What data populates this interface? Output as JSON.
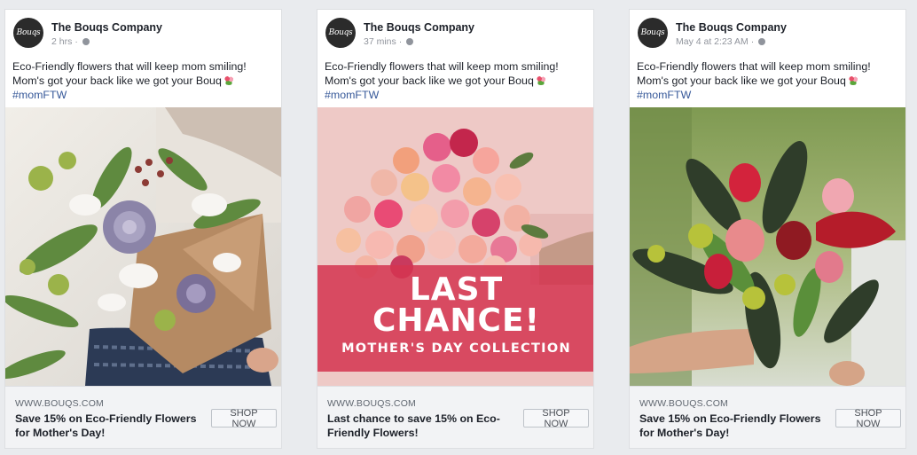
{
  "brand": {
    "page_name": "The Bouqs Company",
    "avatar_text": "Bouqs"
  },
  "posts": [
    {
      "time": "2 hrs",
      "separator": "·",
      "body_line1": "Eco-Friendly flowers that will keep mom smiling!",
      "body_line2": "Mom's got your back like we got your Bouq",
      "hashtag": "#momFTW",
      "link_url": "WWW.BOUQS.COM",
      "headline": "Save 15% on Eco-Friendly Flowers for Mother's Day!",
      "cta": "SHOP NOW",
      "image": "mixed-bouquet-in-kraft-paper"
    },
    {
      "time": "37 mins",
      "separator": "·",
      "body_line1": "Eco-Friendly flowers that will keep mom smiling!",
      "body_line2": "Mom's got your back like we got your Bouq",
      "hashtag": "#momFTW",
      "link_url": "WWW.BOUQS.COM",
      "headline": "Last chance to save 15% on Eco-Friendly Flowers!",
      "cta": "SHOP NOW",
      "image": "pink-rose-bouquet",
      "overlay_line1": "LAST",
      "overlay_line2": "CHANCE!",
      "overlay_sub": "MOTHER'S DAY COLLECTION"
    },
    {
      "time": "May 4 at 2:23 AM",
      "separator": "·",
      "body_line1": "Eco-Friendly flowers that will keep mom smiling!",
      "body_line2": "Mom's got your back like we got your Bouq",
      "hashtag": "#momFTW",
      "link_url": "WWW.BOUQS.COM",
      "headline": "Save 15% on Eco-Friendly Flowers for Mother's Day!",
      "cta": "SHOP NOW",
      "image": "tropical-red-bouquet"
    }
  ],
  "colors": {
    "background": "#e9ebee",
    "hashtag": "#365899",
    "overlay": "#d43450"
  }
}
